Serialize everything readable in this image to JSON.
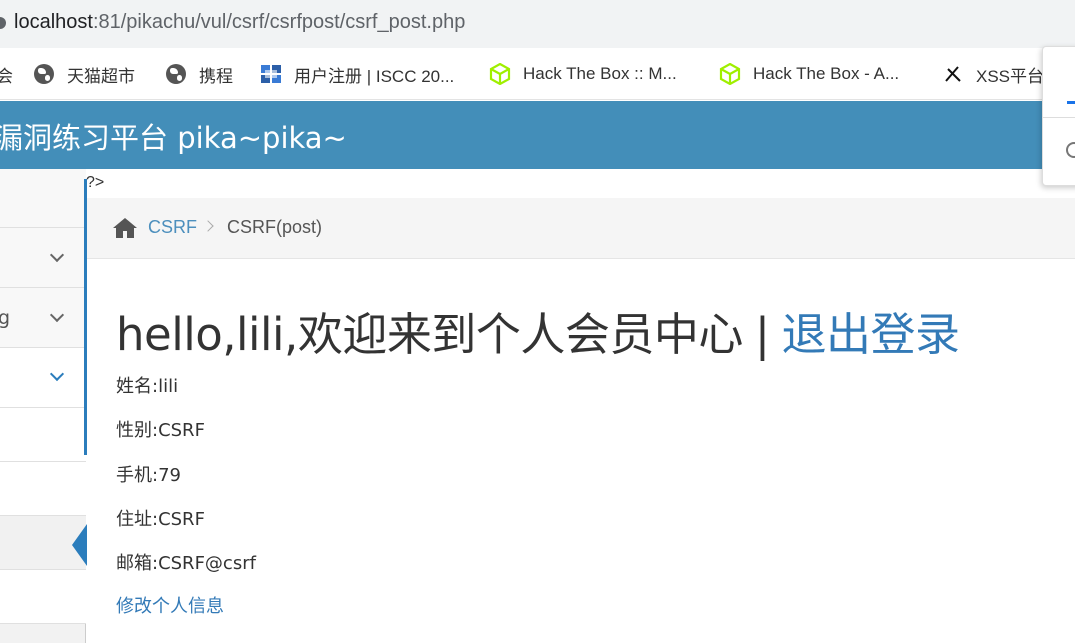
{
  "browser": {
    "url_host": "localhost",
    "url_path": ":81/pikachu/vul/csrf/csrfpost/csrf_post.php",
    "bookmarks": [
      {
        "label": "会",
        "icon": "globe-icon"
      },
      {
        "label": "天猫超市",
        "icon": "globe-icon"
      },
      {
        "label": "携程",
        "icon": "globe-icon"
      },
      {
        "label": "用户注册 | ISCC 20...",
        "icon": "iscc-icon"
      },
      {
        "label": "Hack The Box :: M...",
        "icon": "htb-cube-icon"
      },
      {
        "label": "Hack The Box - A...",
        "icon": "htb-cube-icon"
      },
      {
        "label": "XSS平台",
        "icon": "xss-icon"
      }
    ]
  },
  "header": {
    "title": "漏洞练习平台 pika~pika~"
  },
  "sidebar": {
    "items": [
      {
        "label": "",
        "expanded": false
      },
      {
        "label": "g",
        "expanded": false
      },
      {
        "label": "",
        "expanded": true
      },
      {
        "label": ""
      },
      {
        "label": ""
      },
      {
        "label": "",
        "active": true
      },
      {
        "label": ""
      }
    ]
  },
  "content": {
    "php_leak": "?>",
    "breadcrumb": {
      "link": "CSRF",
      "current": "CSRF(post)"
    },
    "welcome": "hello,lili,欢迎来到个人会员中心",
    "separator": "|",
    "logout": "退出登录",
    "fields": [
      "姓名:lili",
      "性别:CSRF",
      "手机:79",
      "住址:CSRF",
      "邮箱:CSRF@csrf"
    ],
    "edit_link": "修改个人信息"
  },
  "colors": {
    "header_bg": "#438eb9",
    "link": "#337ab7",
    "active_bar": "#2b7dbc",
    "htb_green": "#9fef00"
  }
}
